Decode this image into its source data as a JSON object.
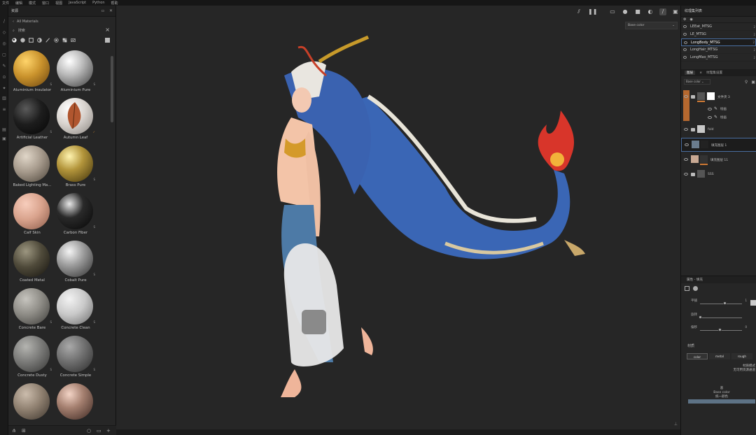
{
  "menubar": {
    "items": [
      "文件",
      "编辑",
      "模式",
      "窗口",
      "视图",
      "JavaScript",
      "Python",
      "帮助"
    ]
  },
  "assets": {
    "title": "资源",
    "path": "All Materials",
    "search_placeholder": "搜索",
    "materials": [
      {
        "name": "Aluminium Insulator",
        "color": "#c9922c"
      },
      {
        "name": "Aluminium Pure",
        "color": "#b9b9b9"
      },
      {
        "name": "Artificial Leather",
        "color": "#1d1d1d"
      },
      {
        "name": "Autumn Leaf",
        "color": "#d9d4cf"
      },
      {
        "name": "Baked Lighting Ma...",
        "color": "#a69a8c"
      },
      {
        "name": "Brass Pure",
        "color": "#b3953b"
      },
      {
        "name": "Calf Skin",
        "color": "#d9a38d"
      },
      {
        "name": "Carbon Fiber",
        "color": "#2a2a2a"
      },
      {
        "name": "Coated Metal",
        "color": "#4f4a3a"
      },
      {
        "name": "Cobalt Pure",
        "color": "#9e9e9e"
      },
      {
        "name": "Concrete Bare",
        "color": "#8e8c86"
      },
      {
        "name": "Concrete Clean",
        "color": "#c9c9c9"
      },
      {
        "name": "Concrete Dusty",
        "color": "#7a7a78"
      },
      {
        "name": "Concrete Simple",
        "color": "#6e6e6e"
      },
      {
        "name": "",
        "color": "#8f8070"
      },
      {
        "name": "",
        "color": "#a58070"
      }
    ]
  },
  "viewport": {
    "channel": "Base color"
  },
  "texture_sets": {
    "title": "纹理集列表",
    "items": [
      {
        "name": "LEEat_MTSG",
        "count": "2"
      },
      {
        "name": "LE_MTSG",
        "count": "2"
      },
      {
        "name": "LongBody_MTSG",
        "count": "2"
      },
      {
        "name": "LongHair_MTSG",
        "count": "2"
      },
      {
        "name": "LongMao_MTSG",
        "count": "2"
      }
    ]
  },
  "layers": {
    "tab_layers": "图层",
    "tab_settings": "纹理集设置",
    "blend_mode": "Base color",
    "items": [
      {
        "name": "文件夹 3"
      },
      {
        "name": "fold"
      },
      {
        "name": "填充图层 1"
      },
      {
        "name": "填充图层 11"
      },
      {
        "name": "SSS"
      }
    ],
    "effects": [
      "绘画",
      "绘画"
    ]
  },
  "properties": {
    "header": "属性 - 填充",
    "sliders": [
      {
        "label": "平铺",
        "value": "1",
        "pos": 0.6
      },
      {
        "label": "旋转",
        "value": "",
        "pos": 0.02
      },
      {
        "label": "偏移",
        "value": "0",
        "pos": 0.48
      }
    ],
    "material_label": "材质",
    "channels": [
      "color",
      "metal",
      "rough"
    ],
    "info_line1": "材质模式",
    "info_line2": "无可用资源通道",
    "base_color_line1": "基",
    "base_color_line2": "Base color",
    "base_color_line3": "统一颜色",
    "swatch_color": "#5d7285"
  }
}
